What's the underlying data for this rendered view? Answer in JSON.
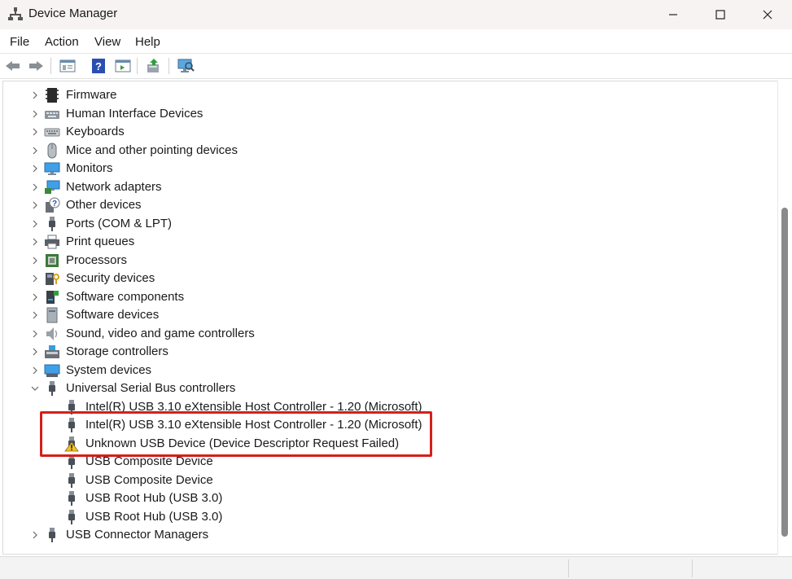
{
  "window": {
    "title": "Device Manager",
    "minimize_glyph": "—",
    "maximize_glyph": "☐",
    "close_glyph": "✕"
  },
  "menu": [
    {
      "label": "File"
    },
    {
      "label": "Action"
    },
    {
      "label": "View"
    },
    {
      "label": "Help"
    }
  ],
  "toolbar": {
    "icons": [
      "back-arrow-icon",
      "forward-arrow-icon",
      "properties-icon",
      "help-icon",
      "scope-icon",
      "update-driver-icon",
      "monitor-scan-icon"
    ]
  },
  "tree": {
    "categories_top": [
      {
        "label": "Firmware",
        "icon": "firmware-icon"
      },
      {
        "label": "Human Interface Devices",
        "icon": "hid-icon"
      },
      {
        "label": "Keyboards",
        "icon": "keyboard-icon"
      },
      {
        "label": "Mice and other pointing devices",
        "icon": "mouse-icon"
      },
      {
        "label": "Monitors",
        "icon": "monitor-icon"
      },
      {
        "label": "Network adapters",
        "icon": "network-adapter-icon"
      },
      {
        "label": "Other devices",
        "icon": "other-devices-icon"
      },
      {
        "label": "Ports (COM & LPT)",
        "icon": "port-icon"
      },
      {
        "label": "Print queues",
        "icon": "printer-icon"
      },
      {
        "label": "Processors",
        "icon": "processor-icon"
      },
      {
        "label": "Security devices",
        "icon": "security-device-icon"
      },
      {
        "label": "Software components",
        "icon": "software-components-icon"
      },
      {
        "label": "Software devices",
        "icon": "software-devices-icon"
      },
      {
        "label": "Sound, video and game controllers",
        "icon": "speaker-icon"
      },
      {
        "label": "Storage controllers",
        "icon": "storage-controller-icon"
      },
      {
        "label": "System devices",
        "icon": "system-devices-icon"
      }
    ],
    "usb_category": {
      "label": "Universal Serial Bus controllers",
      "icon": "usb-plug-icon"
    },
    "usb_children": [
      {
        "label": "Intel(R) USB 3.10 eXtensible Host Controller - 1.20 (Microsoft)",
        "icon": "usb-plug-icon"
      },
      {
        "label": "Intel(R) USB 3.10 eXtensible Host Controller - 1.20 (Microsoft)",
        "icon": "usb-plug-icon"
      },
      {
        "label": "Unknown USB Device (Device Descriptor Request Failed)",
        "icon": "warning-icon"
      },
      {
        "label": "USB Composite Device",
        "icon": "usb-plug-icon"
      },
      {
        "label": "USB Composite Device",
        "icon": "usb-plug-icon"
      },
      {
        "label": "USB Root Hub (USB 3.0)",
        "icon": "usb-plug-icon"
      },
      {
        "label": "USB Root Hub (USB 3.0)",
        "icon": "usb-plug-icon"
      }
    ],
    "categories_bottom": [
      {
        "label": "USB Connector Managers",
        "icon": "usb-plug-icon"
      }
    ]
  },
  "colors": {
    "highlight_border": "#d4201a",
    "warning_yellow": "#f2c02a"
  }
}
